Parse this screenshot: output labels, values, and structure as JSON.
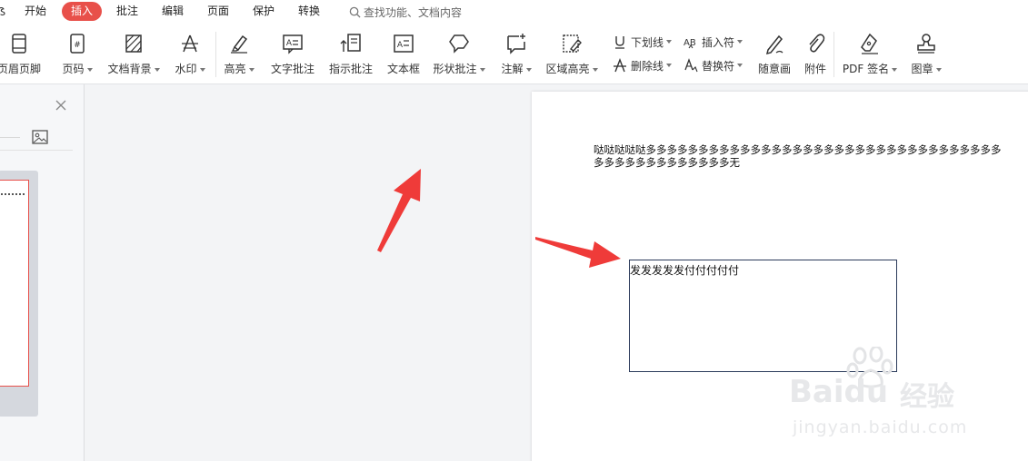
{
  "menubar": {
    "fragment": "ẞ",
    "items": [
      {
        "label": "开始",
        "active": false
      },
      {
        "label": "插入",
        "active": true
      },
      {
        "label": "批注",
        "active": false
      },
      {
        "label": "编辑",
        "active": false
      },
      {
        "label": "页面",
        "active": false
      },
      {
        "label": "保护",
        "active": false
      },
      {
        "label": "转换",
        "active": false
      }
    ],
    "search_placeholder": "查找功能、文档内容"
  },
  "toolbar": {
    "header_footer": "页眉页脚",
    "page_number": "页码",
    "doc_background": "文档背景",
    "watermark": "水印",
    "highlight": "高亮",
    "text_comment": "文字批注",
    "pointer_comment": "指示批注",
    "text_box": "文本框",
    "shape_comment": "形状批注",
    "annotation": "注解",
    "area_highlight": "区域高亮",
    "underline": "下划线",
    "strikethrough": "删除线",
    "insert_mark": "插入符",
    "replace_mark": "替换符",
    "freehand": "随意画",
    "attachment": "附件",
    "pdf_sign": "PDF 签名",
    "stamp": "图章"
  },
  "document": {
    "paragraph_line1": "哒哒哒哒哒多多多多多多多多多多多多多多多多多多多多多多多多多多多多多多多多多多",
    "paragraph_line2": "多多多多多多多多多多多多多无",
    "textbox_text": "发发发发发付付付付付"
  },
  "watermark": {
    "brand": "Baidu",
    "brand_cn": "经验",
    "url": "jingyan.baidu.com"
  },
  "colors": {
    "accent": "#e8504a",
    "arrow": "#ef3b39",
    "textbox_border": "#2b3a5a"
  }
}
